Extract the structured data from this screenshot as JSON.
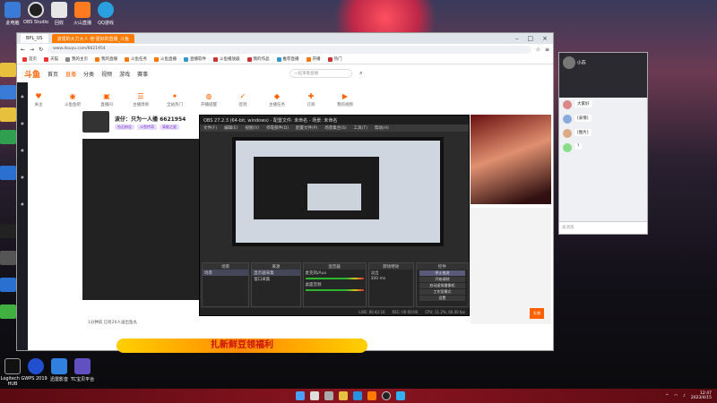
{
  "desktop": {
    "top_icons": [
      "此电脑",
      "OBS Studio",
      "回收",
      "火山直播",
      "QQ游戏"
    ],
    "bottom_icons": [
      "Logitech G HUB",
      "WPS 2019",
      "迅雷影音",
      "TC宝贝平台"
    ]
  },
  "browser": {
    "tabs": [
      {
        "label": "BPL_US"
      },
      {
        "label": "波妞的大力大人 他'强好的直播_斗鱼"
      }
    ],
    "url": "www.douyu.com/6621954",
    "bookmarks": [
      "首页",
      "天猫",
      "我的主页",
      "我的直播",
      "斗鱼任务",
      "斗鱼直播",
      "直播软件",
      "斗鱼播放器",
      "我的作品",
      "推荐直播",
      "开播",
      "热门"
    ],
    "site": {
      "logo": "斗鱼",
      "nav": [
        "首页",
        "直播",
        "分类",
        "视频",
        "游戏",
        "赛事"
      ],
      "active_nav": "直播",
      "search_placeholder": "一起来看直播"
    },
    "icon_row": [
      "关注",
      "斗鱼鱼吧",
      "直播间",
      "主播周榜",
      "全站热门",
      "开播提醒",
      "签到",
      "主播任务",
      "订阅",
      "我的视频"
    ],
    "streamer": {
      "room_title": "波仔：只为一人播 6621954",
      "tags": [
        "钻石粉丝",
        "斗鱼传奇",
        "高能之星"
      ]
    },
    "chat_panel": {
      "gift_label": "礼物"
    },
    "player_bar": "1分钟前 已有20人送出鱼丸",
    "banner": "扎新鲜豆领福利"
  },
  "obs": {
    "title": "OBS 27.2.3 (64-bit, windows) - 配置文件: 未命名 - 场景: 未命名",
    "menu": [
      "文件(F)",
      "编辑(E)",
      "视图(V)",
      "停靠部件(D)",
      "配置文件(P)",
      "场景集合(S)",
      "工具(T)",
      "帮助(H)"
    ],
    "docks": {
      "scenes": {
        "title": "场景",
        "items": [
          "场景"
        ]
      },
      "sources": {
        "title": "来源",
        "items": [
          "显示器采集",
          "窗口采集"
        ]
      },
      "mixer": {
        "title": "混音器",
        "items": [
          "麦克风/Aux",
          "桌面音频"
        ]
      },
      "transitions": {
        "title": "转场特效",
        "items": [
          "淡出",
          "300 ms"
        ]
      },
      "controls": {
        "title": "控件",
        "items": [
          "停止推流",
          "开始录制",
          "启动虚拟摄像机",
          "工作室模式",
          "设置",
          "退出"
        ]
      }
    },
    "status": [
      "LIVE: 00:42:16",
      "REC: 00:00:00",
      "CPU: 11.2%, 60.00 fps"
    ]
  },
  "qq": {
    "group_name": "小苏",
    "messages": [
      {
        "user": "小苏",
        "text": "大家好"
      },
      {
        "user": "群友",
        "text": "[表情]"
      },
      {
        "user": "群友",
        "text": "[图片]"
      },
      {
        "user": "群友",
        "text": "?"
      }
    ],
    "input_placeholder": "发消息"
  },
  "taskbar": {
    "time": "12:47",
    "date": "2023/4/15"
  }
}
